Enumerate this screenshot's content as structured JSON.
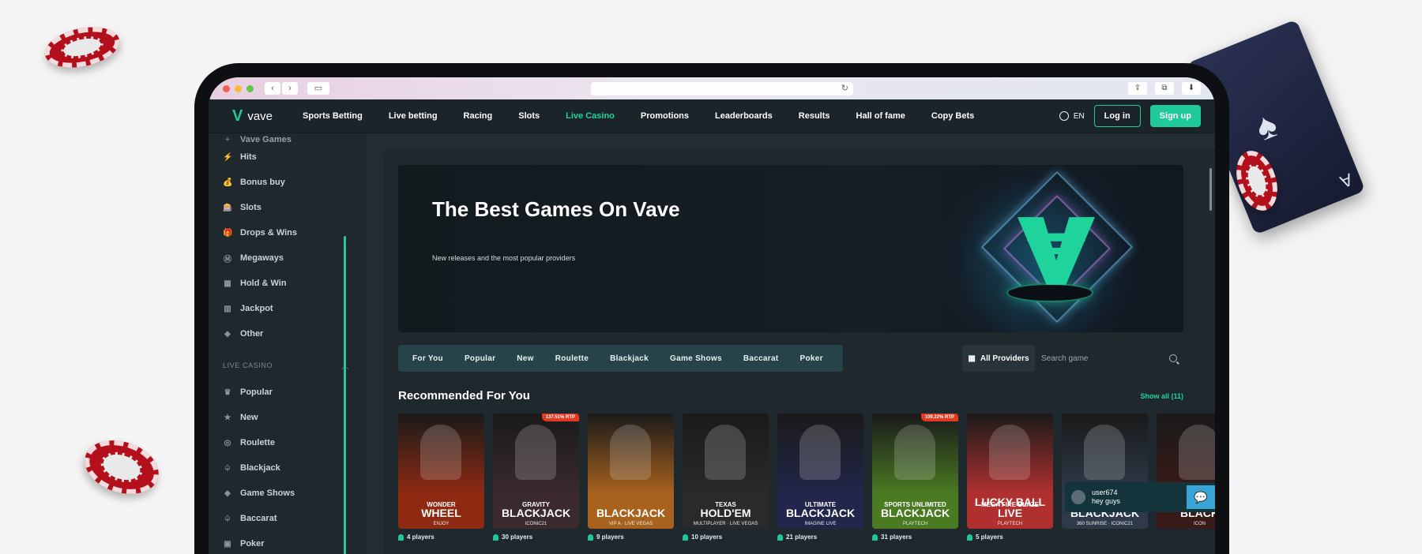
{
  "decor": {
    "card_rank": "A",
    "card_suit": "♠"
  },
  "browser": {
    "url_icon": "↻",
    "back": "‹",
    "forward": "›"
  },
  "header": {
    "logo_text": "vave",
    "nav": [
      {
        "label": "Sports Betting",
        "active": false
      },
      {
        "label": "Live betting",
        "active": false
      },
      {
        "label": "Racing",
        "active": false
      },
      {
        "label": "Slots",
        "active": false
      },
      {
        "label": "Live Casino",
        "active": true
      },
      {
        "label": "Promotions",
        "active": false
      },
      {
        "label": "Leaderboards",
        "active": false
      },
      {
        "label": "Results",
        "active": false
      },
      {
        "label": "Hall of fame",
        "active": false
      },
      {
        "label": "Copy Bets",
        "active": false
      }
    ],
    "language": "EN",
    "login_label": "Log in",
    "signup_label": "Sign up"
  },
  "sidebar": {
    "partial_top": "Vave Games",
    "items": [
      {
        "label": "Hits",
        "icon": "⚡"
      },
      {
        "label": "Bonus buy",
        "icon": "💰"
      },
      {
        "label": "Slots",
        "icon": "🎰"
      },
      {
        "label": "Drops & Wins",
        "icon": "🎁"
      },
      {
        "label": "Megaways",
        "icon": "Ⓜ"
      },
      {
        "label": "Hold & Win",
        "icon": "▦"
      },
      {
        "label": "Jackpot",
        "icon": "▥"
      },
      {
        "label": "Other",
        "icon": "◈"
      }
    ],
    "section_title": "LIVE CASINO",
    "live_items": [
      {
        "label": "Popular",
        "icon": "♛"
      },
      {
        "label": "New",
        "icon": "★"
      },
      {
        "label": "Roulette",
        "icon": "◎"
      },
      {
        "label": "Blackjack",
        "icon": "♤"
      },
      {
        "label": "Game Shows",
        "icon": "◈"
      },
      {
        "label": "Baccarat",
        "icon": "♤"
      },
      {
        "label": "Poker",
        "icon": "▣"
      }
    ]
  },
  "hero": {
    "title": "The Best Games On Vave",
    "subtitle": "New releases and the most popular providers"
  },
  "tabs": [
    "For You",
    "Popular",
    "New",
    "Roulette",
    "Blackjack",
    "Game Shows",
    "Baccarat",
    "Poker"
  ],
  "filters": {
    "providers_label": "All Providers",
    "search_placeholder": "Search game"
  },
  "recommended": {
    "title": "Recommended For You",
    "show_all": "Show all (11)",
    "games": [
      {
        "line1": "WONDER",
        "line2": "WHEEL",
        "provider": "ENJOY",
        "players": "4 players",
        "rtp": "",
        "color": "#8f2a12"
      },
      {
        "line1": "GRAVITY",
        "line2": "BLACKJACK",
        "provider": "ICONIC21",
        "players": "30 players",
        "rtp": "137.51% RTP",
        "color": "#3a2a2e"
      },
      {
        "line1": "",
        "line2": "BLACKJACK",
        "provider": "VIP A · LIVE VEGAS",
        "players": "9 players",
        "rtp": "",
        "color": "#a8621e"
      },
      {
        "line1": "TEXAS",
        "line2": "HOLD'EM",
        "provider": "MULTIPLAYER · LIVE VEGAS",
        "players": "10 players",
        "rtp": "",
        "color": "#2a2a2a"
      },
      {
        "line1": "ULTIMATE",
        "line2": "BLACKJACK",
        "provider": "IMAGINE LIVE",
        "players": "21 players",
        "rtp": "",
        "color": "#22264a"
      },
      {
        "line1": "SPORTS UNLIMITED",
        "line2": "BLACKJACK",
        "provider": "PLAYTECH",
        "players": "31 players",
        "rtp": "109.22% RTP",
        "color": "#4a7a22"
      },
      {
        "line1": "MEGA FIRE BLAZE",
        "line2": "LUCKY BALL LIVE",
        "provider": "PLAYTECH",
        "players": "5 players",
        "rtp": "",
        "color": "#b0302f"
      },
      {
        "line1": "360° BLACKJACK Sunrise",
        "line2": "BLACKJACK",
        "provider": "360 SUNRISE · ICONIC21",
        "players": "",
        "rtp": "",
        "color": "#2e3a4a"
      },
      {
        "line1": "GRAND",
        "line2": "BLACK",
        "provider": "ICON",
        "players": "",
        "rtp": "",
        "color": "#3a1a18"
      }
    ]
  },
  "chat": {
    "user": "user674",
    "message": "hey guys"
  }
}
